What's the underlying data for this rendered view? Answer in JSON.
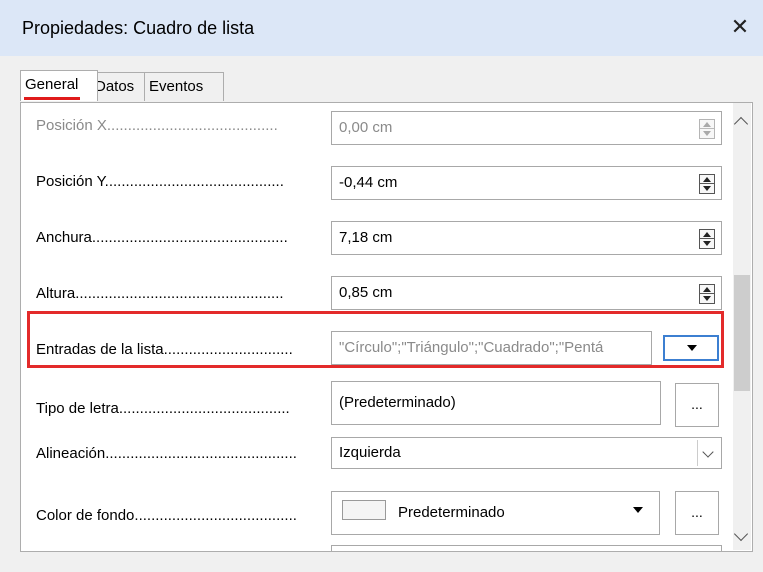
{
  "window": {
    "title": "Propiedades: Cuadro de lista",
    "close_glyph": "✕"
  },
  "tabs": [
    {
      "label": "General",
      "active": true
    },
    {
      "label": "Datos",
      "active": false
    },
    {
      "label": "Eventos",
      "active": false
    }
  ],
  "rows": {
    "pos_x": {
      "label": "Posición X",
      "value": "0,00 cm",
      "disabled": true
    },
    "pos_y": {
      "label": "Posición Y",
      "value": "-0,44 cm"
    },
    "width": {
      "label": "Anchura",
      "value": "7,18 cm"
    },
    "height": {
      "label": "Altura",
      "value": "0,85 cm"
    },
    "list_entries": {
      "label": "Entradas de la lista",
      "value": "\"Círculo\";\"Triángulo\";\"Cuadrado\";\"Pentá"
    },
    "font": {
      "label": "Tipo de letra",
      "value": "(Predeterminado)",
      "button": "..."
    },
    "alignment": {
      "label": "Alineación",
      "value": "Izquierda"
    },
    "bg_color": {
      "label": "Color de fondo",
      "value": "Predeterminado",
      "button": "..."
    }
  },
  "colors": {
    "highlight": "#e32a2a",
    "titlebar": "#dce7f7",
    "focus": "#3c7fd1"
  }
}
